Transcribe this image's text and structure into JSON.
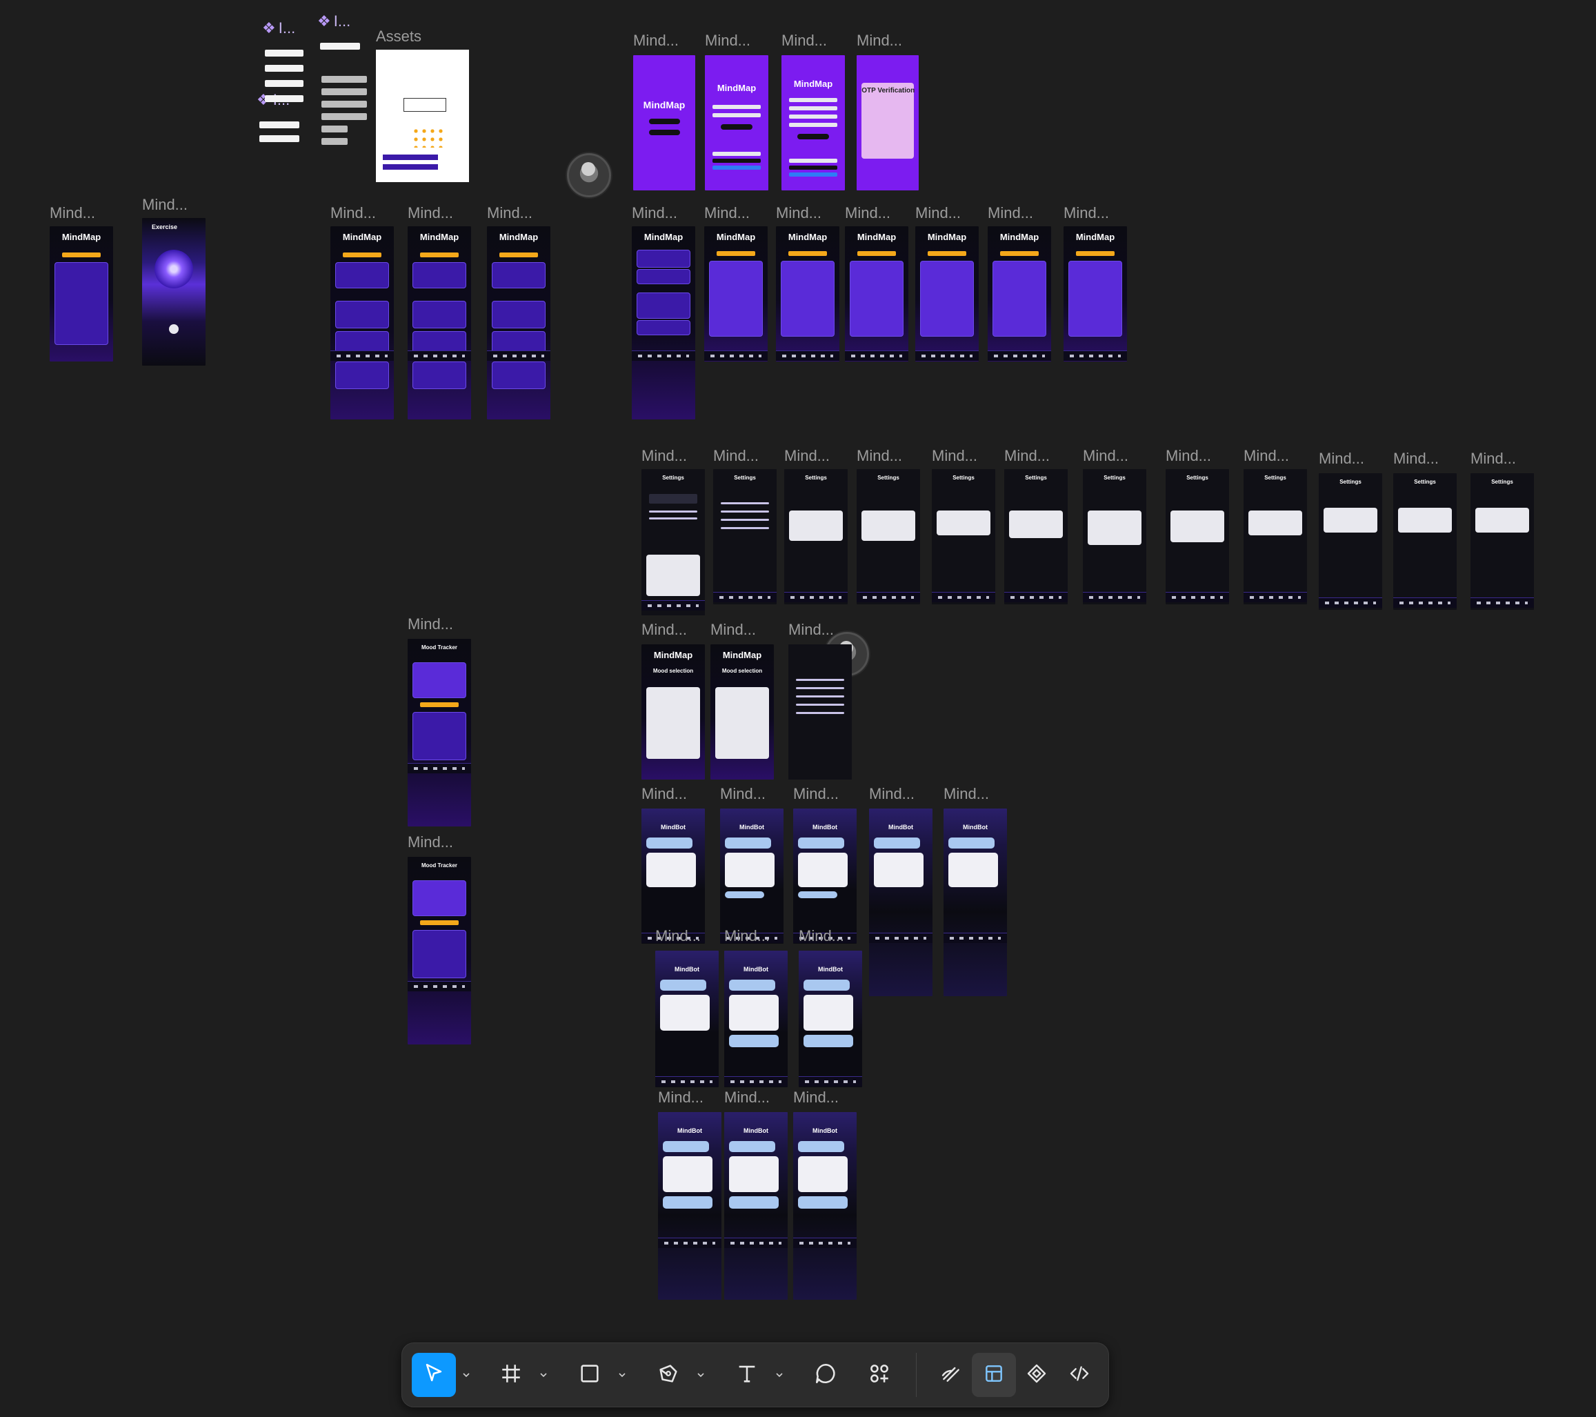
{
  "canvas": {
    "frame_label": "Mind...",
    "assets_label": "Assets",
    "component_labels": [
      "I...",
      "I...",
      "I..."
    ],
    "app_titles": {
      "mindmap": "MindMap",
      "mindbot": "MindBot",
      "otp": "OTP Verification",
      "exercise": "Exercise",
      "settings": "Settings",
      "mood_tracker": "Mood Tracker",
      "mood_selection": "Mood selection"
    }
  },
  "toolbar": {
    "tools": [
      {
        "name": "move-tool",
        "icon": "cursor-arrow-icon",
        "active": true,
        "caret": true
      },
      {
        "name": "frame-tool",
        "icon": "frame-hash-icon",
        "active": false,
        "caret": true
      },
      {
        "name": "shape-tool",
        "icon": "rectangle-icon",
        "active": false,
        "caret": true
      },
      {
        "name": "pen-tool",
        "icon": "pen-nib-icon",
        "active": false,
        "caret": true
      },
      {
        "name": "text-tool",
        "icon": "text-t-icon",
        "active": false,
        "caret": true
      },
      {
        "name": "comment-tool",
        "icon": "speech-bubble-icon",
        "active": false,
        "caret": false
      },
      {
        "name": "actions-tool",
        "icon": "components-plus-icon",
        "active": false,
        "caret": false
      }
    ],
    "modes": [
      {
        "name": "draw-mode",
        "icon": "draw-pencil-icon",
        "active": false
      },
      {
        "name": "design-mode",
        "icon": "design-layout-icon",
        "active": true
      },
      {
        "name": "prototype-mode",
        "icon": "prototype-diamond-icon",
        "active": false
      },
      {
        "name": "dev-mode",
        "icon": "code-brackets-icon",
        "active": false
      }
    ],
    "accent_color": "#0d99ff"
  },
  "colors": {
    "canvas_bg": "#1e1e1e",
    "brand_purple": "#7c1cf0",
    "accent_orange": "#f4a81a",
    "frame_label": "#9c9c9c"
  }
}
